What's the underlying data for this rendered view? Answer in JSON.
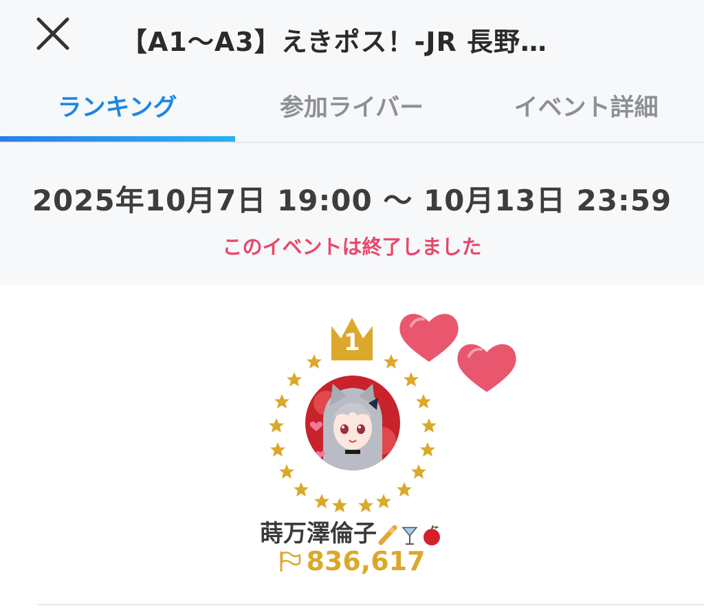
{
  "header": {
    "title": "【A1〜A3】えきポス！-JR 長野…"
  },
  "tabs": [
    {
      "label": "ランキング",
      "active": true
    },
    {
      "label": "参加ライバー",
      "active": false
    },
    {
      "label": "イベント詳細",
      "active": false
    }
  ],
  "period": {
    "text": "2025年10月7日 19:00 〜 10月13日 23:59",
    "status": "このイベントは終了しました"
  },
  "ranking": {
    "rank": "1",
    "name": "蒔万澤倫子",
    "score": "836,617"
  },
  "colors": {
    "accent": "#1d86e6",
    "ended": "#e8476d",
    "gold": "#dba82a",
    "heart": "#e8576e"
  },
  "icons": [
    "close-icon",
    "crown-icon",
    "star-icon",
    "heart-icon",
    "flag-icon"
  ]
}
